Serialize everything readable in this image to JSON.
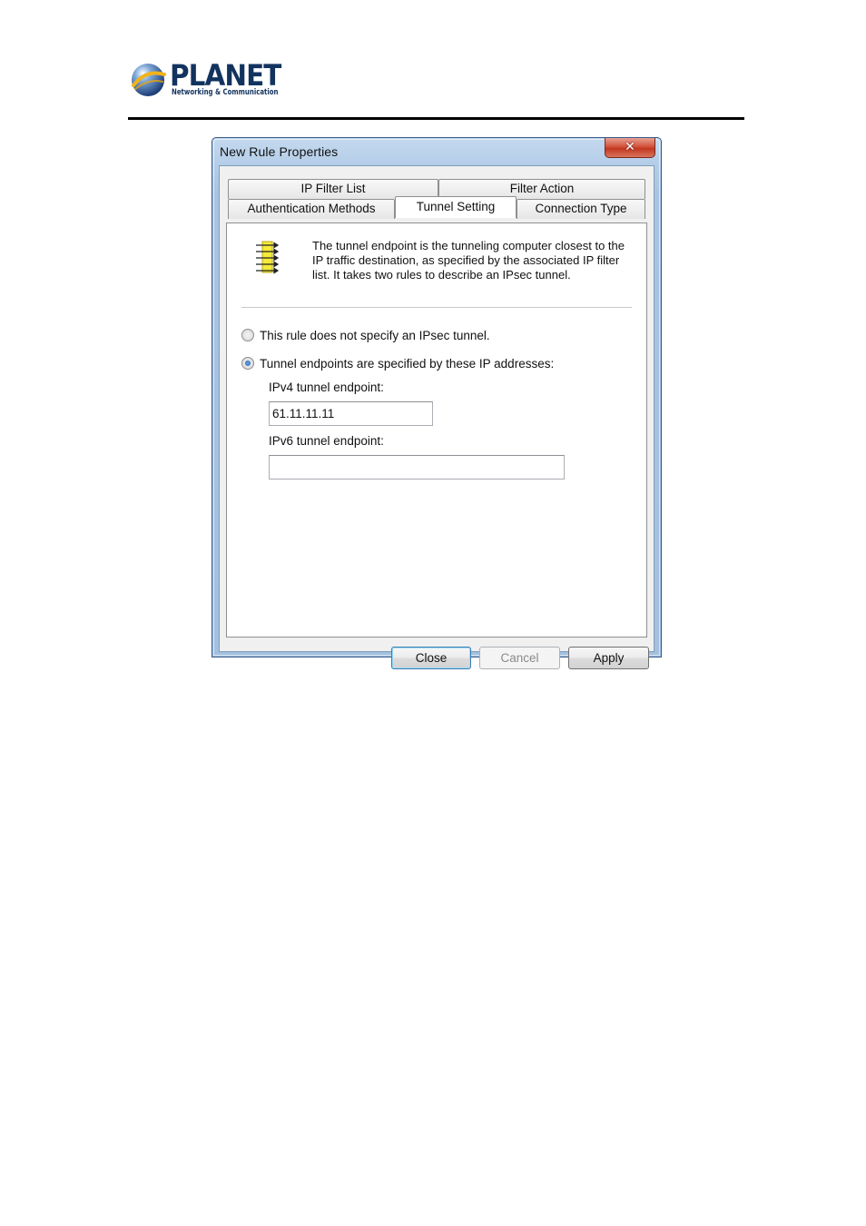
{
  "document": {
    "logo_word": "PLANET",
    "logo_tagline": "Networking & Communication"
  },
  "dialog": {
    "title": "New Rule Properties",
    "close_glyph": "✕",
    "tabs_back": [
      "IP Filter List",
      "Filter Action"
    ],
    "tabs_front": [
      "Authentication Methods",
      "Tunnel Setting",
      "Connection Type"
    ],
    "active_tab": "Tunnel Setting",
    "icon": "tunnel-endpoint-icon",
    "description": "The tunnel endpoint is the tunneling computer closest to the IP traffic destination, as specified by the associated IP filter list. It takes two rules to describe an IPsec tunnel.",
    "radio_no_tunnel": "This rule does not specify an IPsec tunnel.",
    "radio_tunnel": "Tunnel endpoints are specified by these IP addresses:",
    "selected_option": "radio_tunnel",
    "ipv4_label": "IPv4 tunnel endpoint:",
    "ipv4_value": "61.11.11.11",
    "ipv6_label": "IPv6 tunnel endpoint:",
    "ipv6_value": "",
    "buttons": {
      "close": "Close",
      "cancel": "Cancel",
      "apply": "Apply"
    }
  },
  "colors": {
    "brand": "#13335f",
    "window_frame": "#a9c4e2",
    "close_button": "#c2381f",
    "default_button_border": "#3c7fb1"
  }
}
